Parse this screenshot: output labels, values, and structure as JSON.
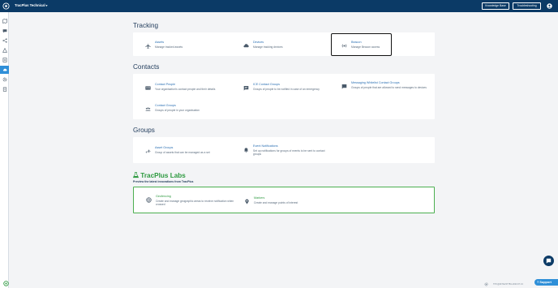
{
  "header": {
    "org_name": "TracPlus Technical",
    "caret": "▾",
    "knowledge_base": "Knowledge Base",
    "troubleshooting": "Troubleshooting"
  },
  "sections": {
    "tracking": {
      "title": "Tracking",
      "items": [
        {
          "title": "Assets",
          "desc": "Manage tracked assets",
          "icon": "aircraft-icon"
        },
        {
          "title": "Devices",
          "desc": "Manage tracking devices",
          "icon": "cloud-device-icon"
        },
        {
          "title": "Beacon",
          "desc": "Manage Beacon access",
          "icon": "beacon-icon"
        }
      ]
    },
    "contacts": {
      "title": "Contacts",
      "items": [
        {
          "title": "Contact People",
          "desc": "Your organisation's contact people and their details",
          "icon": "contact-card-icon"
        },
        {
          "title": "ICE Contact Groups",
          "desc": "Groups of people to be notified in case of an emergency",
          "icon": "message-icon"
        },
        {
          "title": "Messaging Whitelist Contact Groups",
          "desc": "Groups of people that are allowed to send messages to devices",
          "icon": "chat-icon"
        },
        {
          "title": "Contact Groups",
          "desc": "Groups of people in your organisation",
          "icon": "group-icon"
        }
      ]
    },
    "groups": {
      "title": "Groups",
      "items": [
        {
          "title": "Asset Groups",
          "desc": "Group of assets that can be managed as a set",
          "icon": "asset-group-icon"
        },
        {
          "title": "Event Notifications",
          "desc": "Set up notifications for groups of events to be sent to contact groups",
          "icon": "bell-icon"
        }
      ]
    },
    "labs": {
      "title_brand": "TracPlus",
      "title_suffix": "Labs",
      "subtitle": "Preview the latest innovations from TracPlus",
      "items": [
        {
          "title": "Geofencing",
          "desc": "Create and manage geographic areas to receive notification when crossed",
          "icon": "geofence-icon"
        },
        {
          "title": "Markers",
          "desc": "Create and manage points of interest",
          "icon": "marker-icon"
        }
      ]
    }
  },
  "footer": {
    "version": "TPC@2F7E2377B1-2023.07.13",
    "support": "Support"
  },
  "colors": {
    "header_bg": "#0b3a66",
    "accent": "#2f8fd8",
    "link": "#2a6fb3",
    "labs_green": "#2e9a40"
  }
}
